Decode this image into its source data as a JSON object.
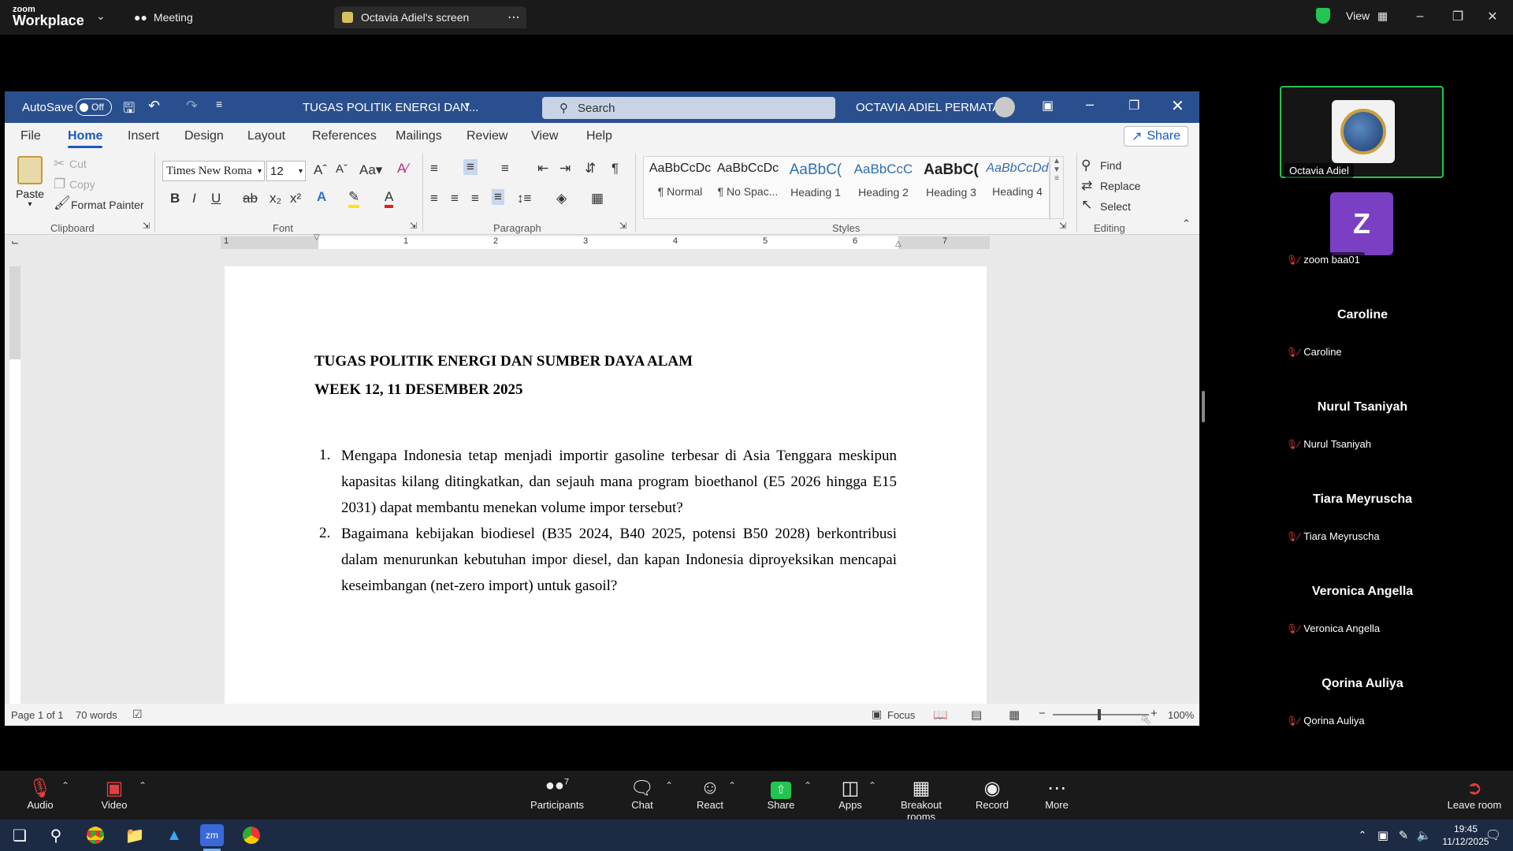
{
  "zoom": {
    "brand_small": "zoom",
    "brand_big": "Workplace",
    "meeting_tab": "Meeting",
    "screen_tab": "Octavia Adiel's screen",
    "view_label": "View",
    "toolbar": {
      "audio": "Audio",
      "video": "Video",
      "participants": "Participants",
      "participants_count": "7",
      "chat": "Chat",
      "react": "React",
      "share": "Share",
      "apps": "Apps",
      "breakout": "Breakout rooms",
      "record": "Record",
      "more": "More",
      "leave": "Leave room"
    },
    "gallery": [
      {
        "name": "Octavia Adiel",
        "label": "Octavia Adiel",
        "type": "logo"
      },
      {
        "name": "Z",
        "label": "zoom baa01",
        "type": "avatar"
      },
      {
        "name": "Caroline",
        "label": "Caroline",
        "type": "name"
      },
      {
        "name": "Nurul Tsaniyah",
        "label": "Nurul Tsaniyah",
        "type": "name"
      },
      {
        "name": "Tiara Meyruscha",
        "label": "Tiara Meyruscha",
        "type": "name"
      },
      {
        "name": "Veronica Angella",
        "label": "Veronica Angella",
        "type": "name"
      },
      {
        "name": "Qorina Auliya",
        "label": "Qorina Auliya",
        "type": "name"
      }
    ]
  },
  "word": {
    "autosave_label": "AutoSave",
    "autosave_state": "Off",
    "doc_title": "TUGAS POLITIK ENERGI DAN...",
    "search_placeholder": "Search",
    "user_name": "OCTAVIA ADIEL PERMATA",
    "share_label": "Share",
    "tabs": [
      "File",
      "Home",
      "Insert",
      "Design",
      "Layout",
      "References",
      "Mailings",
      "Review",
      "View",
      "Help"
    ],
    "clipboard": {
      "paste": "Paste",
      "cut": "Cut",
      "copy": "Copy",
      "format_painter": "Format Painter",
      "label": "Clipboard"
    },
    "font": {
      "name": "Times New Roma",
      "size": "12",
      "label": "Font"
    },
    "paragraph_label": "Paragraph",
    "styles": [
      {
        "preview": "AaBbCcDc",
        "name": "¶ Normal"
      },
      {
        "preview": "AaBbCcDc",
        "name": "¶ No Spac..."
      },
      {
        "preview": "AaBbC(",
        "name": "Heading 1"
      },
      {
        "preview": "AaBbCcC",
        "name": "Heading 2"
      },
      {
        "preview": "AaBbC(",
        "name": "Heading 3"
      },
      {
        "preview": "AaBbCcDd",
        "name": "Heading 4"
      }
    ],
    "styles_label": "Styles",
    "editing": {
      "find": "Find",
      "replace": "Replace",
      "select": "Select",
      "label": "Editing"
    },
    "ruler_numbers": [
      "1",
      "1",
      "2",
      "3",
      "4",
      "5",
      "6",
      "7"
    ],
    "document": {
      "title_line1": "TUGAS POLITIK ENERGI DAN SUMBER DAYA ALAM",
      "title_line2": "WEEK 12, 11 DESEMBER 2025",
      "items": [
        {
          "num": "1.",
          "text": "Mengapa Indonesia tetap menjadi importir gasoline terbesar di Asia Tenggara meskipun kapasitas kilang ditingkatkan, dan sejauh mana program bioethanol (E5 2026 hingga E15 2031) dapat membantu menekan volume impor tersebut?"
        },
        {
          "num": "2.",
          "text": "Bagaimana kebijakan biodiesel (B35 2024, B40 2025, potensi B50 2028) berkontribusi dalam menurunkan kebutuhan impor diesel, dan kapan Indonesia diproyeksikan mencapai keseimbangan (net-zero import) untuk gasoil?"
        }
      ]
    },
    "status": {
      "page": "Page 1 of 1",
      "words": "70 words",
      "focus": "Focus",
      "zoom": "100%"
    }
  },
  "taskbar": {
    "time": "19:45",
    "date": "11/12/2025"
  },
  "colors": {
    "word_blue": "#2a4f8f",
    "accent": "#185abd",
    "zoom_green": "#23c552",
    "mute_red": "#e04040"
  }
}
